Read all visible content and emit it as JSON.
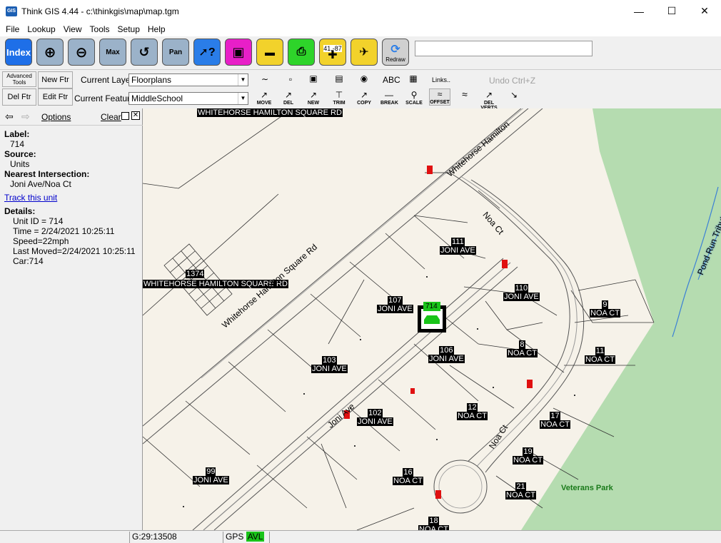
{
  "window": {
    "title": "Think GIS 4.44 - c:\\thinkgis\\map\\map.tgm",
    "icon_text": "THINK GIS"
  },
  "menu": [
    "File",
    "Lookup",
    "View",
    "Tools",
    "Setup",
    "Help"
  ],
  "toolbar": {
    "index_label": "Index",
    "max_label": "Max",
    "pan_label": "Pan",
    "coord_label": "41,-87",
    "redraw_label": "Redraw",
    "search_value": ""
  },
  "editbar": {
    "advanced_tools_label": "Advanced Tools",
    "new_ftr": "New Ftr",
    "del_ftr": "Del Ftr",
    "edit_ftr": "Edit Ftr",
    "current_layer_label": "Current Layer",
    "current_layer_value": "Floorplans",
    "current_feature_label": "Current Feature",
    "current_feature_value": "MiddleSchool",
    "abc_label": "ABC",
    "links_label": "Links..",
    "undo_label": "Undo  Ctrl+Z",
    "tools": [
      "MOVE",
      "DEL",
      "NEW",
      "TRIM",
      "COPY",
      "BREAK",
      "SCALE",
      "OFFSET",
      "",
      "DEL VERTS",
      ""
    ]
  },
  "leftpane": {
    "options": "Options",
    "clear": "Clear",
    "label_heading": "Label:",
    "label_value": "714",
    "source_heading": "Source:",
    "source_value": "Units",
    "intersection_heading": "Nearest Intersection:",
    "intersection_value": "Joni Ave/Noa Ct",
    "track_link": "Track this unit",
    "details_heading": "Details:",
    "details": [
      "Unit ID = 714",
      "Time = 2/24/2021 10:25:11",
      "Speed=22mph",
      "Last Moved=2/24/2021 10:25:11",
      "Car:714"
    ]
  },
  "map": {
    "street_labels": {
      "whitehorse_top": "WHITEHORSE HAMILTON SQUARE RD",
      "whitehorse_left": "WHITEHORSE HAMILTON SQUARE RD",
      "whitehorse_diag": "Whitehorse Hamilton Square Rd",
      "whitehorse_upper": "Whitehorse Hamilton",
      "noa_top": "Noa Ct",
      "noa_bottom": "Noa Ct",
      "joni": "Joni Ave",
      "pond_run": "Pond Run Tributary"
    },
    "parcels": [
      {
        "num": "111",
        "street": "JONI AVE"
      },
      {
        "num": "107",
        "street": "JONI AVE"
      },
      {
        "num": "110",
        "street": "JONI AVE"
      },
      {
        "num": "9",
        "street": "NOA CT"
      },
      {
        "num": "8",
        "street": "NOA CT"
      },
      {
        "num": "11",
        "street": "NOA CT"
      },
      {
        "num": "106",
        "street": "JONI AVE"
      },
      {
        "num": "103",
        "street": "JONI AVE"
      },
      {
        "num": "12",
        "street": "NOA CT"
      },
      {
        "num": "102",
        "street": "JONI AVE"
      },
      {
        "num": "17",
        "street": "NOA CT"
      },
      {
        "num": "19",
        "street": "NOA CT"
      },
      {
        "num": "99",
        "street": "JONI AVE"
      },
      {
        "num": "16",
        "street": "NOA CT"
      },
      {
        "num": "21",
        "street": "NOA CT"
      },
      {
        "num": "18",
        "street": "NOA CT"
      }
    ],
    "building_number": "1374",
    "park_label": "Veterans Park",
    "unit_label": "714",
    "colors": {
      "background": "#f6f2e9",
      "park": "#b5dcb0",
      "water": "#3a7fd6",
      "hydrant": "#e01010",
      "unit_tag": "#19c419"
    }
  },
  "status": {
    "grid": "G:29:13508",
    "gps": "GPS",
    "avl": "AVL"
  }
}
